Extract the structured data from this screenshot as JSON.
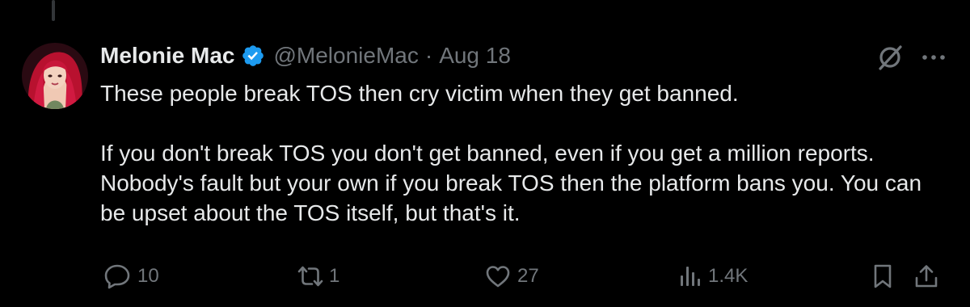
{
  "tweet": {
    "author": {
      "display_name": "Melonie Mac",
      "handle": "@MelonieMac",
      "verified": true,
      "avatar_icon": "profile-photo"
    },
    "separator": "·",
    "date": "Aug 18",
    "paragraphs": [
      "These people break TOS then cry victim when they get banned.",
      "If you don't break TOS you don't get banned, even if you get a million reports. Nobody's fault but your own if you break TOS then the platform bans you. You can be upset about the TOS itself, but that's it."
    ],
    "actions": {
      "replies": "10",
      "reposts": "1",
      "likes": "27",
      "views": "1.4K"
    }
  },
  "colors": {
    "background": "#000000",
    "text": "#e7e9ea",
    "muted": "#71767b",
    "verified_badge": "#1d9bf0"
  },
  "icons": {
    "verified": "verified-badge-icon",
    "grok": "grok-icon",
    "more": "more-options-icon",
    "reply": "reply-icon",
    "repost": "repost-icon",
    "like": "heart-icon",
    "views": "views-icon",
    "bookmark": "bookmark-icon",
    "share": "share-icon"
  }
}
